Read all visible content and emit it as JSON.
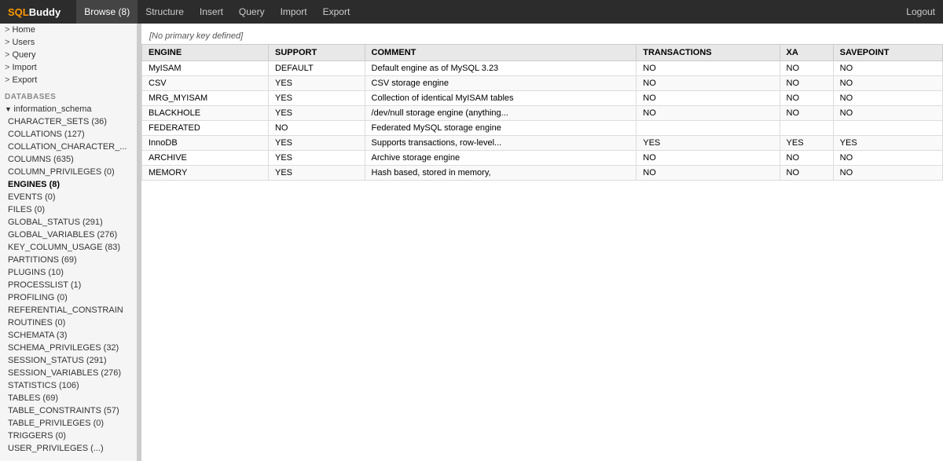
{
  "app": {
    "logo_sql": "SQL",
    "logo_buddy": "Buddy"
  },
  "nav": {
    "items": [
      {
        "label": "Browse (8)",
        "active": true
      },
      {
        "label": "Structure",
        "active": false
      },
      {
        "label": "Insert",
        "active": false
      },
      {
        "label": "Query",
        "active": false
      },
      {
        "label": "Import",
        "active": false
      },
      {
        "label": "Export",
        "active": false
      }
    ],
    "logout_label": "Logout"
  },
  "sidebar": {
    "top_items": [
      {
        "label": "Home"
      },
      {
        "label": "Users"
      },
      {
        "label": "Query"
      },
      {
        "label": "Import"
      },
      {
        "label": "Export"
      }
    ],
    "databases_label": "DATABASES",
    "db_name": "information_schema",
    "db_tables": [
      {
        "label": "CHARACTER_SETS (36)"
      },
      {
        "label": "COLLATIONS (127)"
      },
      {
        "label": "COLLATION_CHARACTER_..."
      },
      {
        "label": "COLUMNS (635)",
        "active": false
      },
      {
        "label": "COLUMN_PRIVILEGES (0)"
      },
      {
        "label": "ENGINES (8)",
        "active": true
      },
      {
        "label": "EVENTS (0)"
      },
      {
        "label": "FILES (0)"
      },
      {
        "label": "GLOBAL_STATUS (291)"
      },
      {
        "label": "GLOBAL_VARIABLES (276)"
      },
      {
        "label": "KEY_COLUMN_USAGE (83)"
      },
      {
        "label": "PARTITIONS (69)"
      },
      {
        "label": "PLUGINS (10)"
      },
      {
        "label": "PROCESSLIST (1)"
      },
      {
        "label": "PROFILING (0)"
      },
      {
        "label": "REFERENTIAL_CONSTRAIN"
      },
      {
        "label": "ROUTINES (0)"
      },
      {
        "label": "SCHEMATA (3)"
      },
      {
        "label": "SCHEMA_PRIVILEGES (32)"
      },
      {
        "label": "SESSION_STATUS (291)"
      },
      {
        "label": "SESSION_VARIABLES (276)"
      },
      {
        "label": "STATISTICS (106)"
      },
      {
        "label": "TABLES (69)"
      },
      {
        "label": "TABLE_CONSTRAINTS (57)"
      },
      {
        "label": "TABLE_PRIVILEGES (0)"
      },
      {
        "label": "TRIGGERS (0)"
      },
      {
        "label": "USER_PRIVILEGES (...)"
      }
    ]
  },
  "content": {
    "no_primary_key": "[No primary key defined]",
    "columns": [
      "ENGINE",
      "SUPPORT",
      "COMMENT",
      "TRANSACTIONS",
      "XA",
      "SAVEPOINT"
    ],
    "rows": [
      {
        "ENGINE": "MyISAM",
        "SUPPORT": "DEFAULT",
        "COMMENT": "Default engine as of MySQL 3.23",
        "TRANSACTIONS": "NO",
        "XA": "NO",
        "SAVEPOINT": "NO"
      },
      {
        "ENGINE": "CSV",
        "SUPPORT": "YES",
        "COMMENT": "CSV storage engine",
        "TRANSACTIONS": "NO",
        "XA": "NO",
        "SAVEPOINT": "NO"
      },
      {
        "ENGINE": "MRG_MYISAM",
        "SUPPORT": "YES",
        "COMMENT": "Collection of identical MyISAM tables",
        "TRANSACTIONS": "NO",
        "XA": "NO",
        "SAVEPOINT": "NO"
      },
      {
        "ENGINE": "BLACKHOLE",
        "SUPPORT": "YES",
        "COMMENT": "/dev/null storage engine (anything...",
        "TRANSACTIONS": "NO",
        "XA": "NO",
        "SAVEPOINT": "NO"
      },
      {
        "ENGINE": "FEDERATED",
        "SUPPORT": "NO",
        "COMMENT": "Federated MySQL storage engine",
        "TRANSACTIONS": "",
        "XA": "",
        "SAVEPOINT": ""
      },
      {
        "ENGINE": "InnoDB",
        "SUPPORT": "YES",
        "COMMENT": "Supports transactions, row-level...",
        "TRANSACTIONS": "YES",
        "XA": "YES",
        "SAVEPOINT": "YES"
      },
      {
        "ENGINE": "ARCHIVE",
        "SUPPORT": "YES",
        "COMMENT": "Archive storage engine",
        "TRANSACTIONS": "NO",
        "XA": "NO",
        "SAVEPOINT": "NO"
      },
      {
        "ENGINE": "MEMORY",
        "SUPPORT": "YES",
        "COMMENT": "Hash based, stored in memory,",
        "TRANSACTIONS": "NO",
        "XA": "NO",
        "SAVEPOINT": "NO"
      }
    ]
  }
}
